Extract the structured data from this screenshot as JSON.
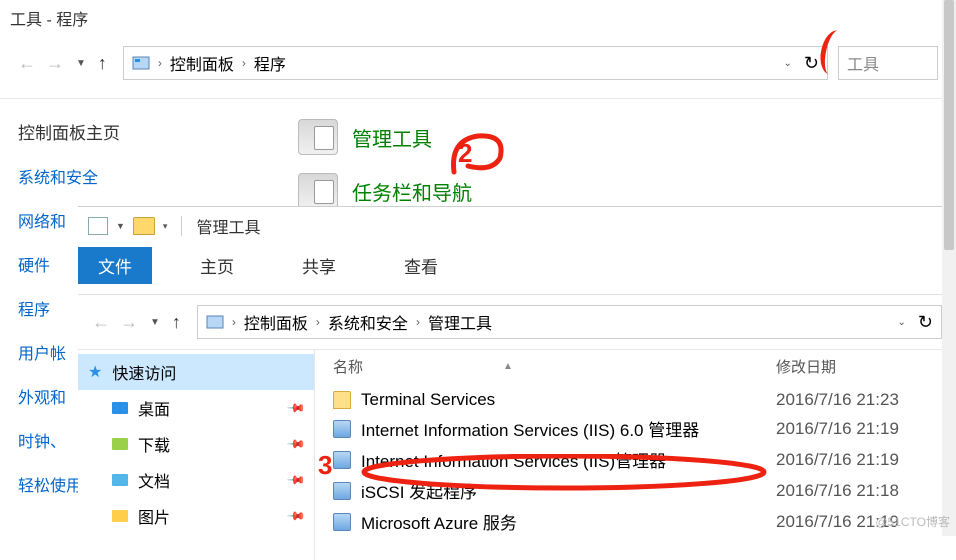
{
  "win1": {
    "title": "工具 - 程序",
    "breadcrumb": {
      "root": "控制面板",
      "current": "程序"
    },
    "search": "工具",
    "sidebar": {
      "header": "控制面板主页",
      "items": [
        "系统和安全",
        "网络和",
        "硬件",
        "程序",
        "用户帐",
        "外观和",
        "时钟、",
        "轻松使用"
      ]
    },
    "tools": [
      {
        "label": "管理工具"
      },
      {
        "label": "任务栏和导航"
      }
    ]
  },
  "win2": {
    "title": "管理工具",
    "ribbon": {
      "file": "文件",
      "tabs": [
        "主页",
        "共享",
        "查看"
      ]
    },
    "breadcrumb": [
      "控制面板",
      "系统和安全",
      "管理工具"
    ],
    "tree": {
      "quick": "快速访问",
      "items": [
        "桌面",
        "下载",
        "文档",
        "图片"
      ]
    },
    "cols": {
      "name": "名称",
      "date": "修改日期"
    },
    "rows": [
      {
        "name": "Terminal Services",
        "date": "2016/7/16 21:23",
        "type": "folder"
      },
      {
        "name": "Internet Information Services (IIS) 6.0 管理器",
        "date": "2016/7/16 21:19",
        "type": "app"
      },
      {
        "name": "Internet Information Services (IIS)管理器",
        "date": "2016/7/16 21:19",
        "type": "app"
      },
      {
        "name": "iSCSI 发起程序",
        "date": "2016/7/16 21:18",
        "type": "app"
      },
      {
        "name": "Microsoft Azure 服务",
        "date": "2016/7/16 21:19",
        "type": "app"
      }
    ]
  },
  "annotations": {
    "n2": "2",
    "n3": "3"
  },
  "watermark": "@51CTO博客"
}
